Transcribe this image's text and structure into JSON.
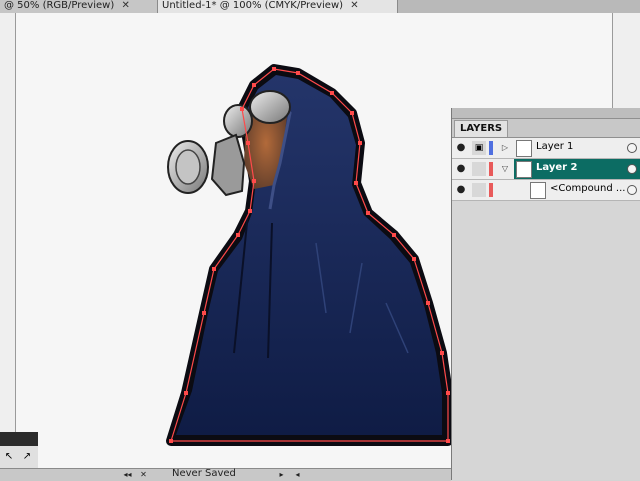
{
  "tabs": [
    {
      "label": "@ 50% (RGB/Preview)",
      "close": "✕"
    },
    {
      "label": "Untitled-1* @ 100% (CMYK/Preview)",
      "close": "✕"
    }
  ],
  "layers_panel": {
    "title": "LAYERS",
    "rows": [
      {
        "name": "Layer 1",
        "color": "#4f6fe0",
        "expand": "▷"
      },
      {
        "name": "Layer 2",
        "color": "#e85a5a",
        "expand": "▽"
      },
      {
        "name": "<Compound ...",
        "color": "#e85a5a",
        "expand": ""
      }
    ]
  },
  "status": {
    "text": "Never Saved",
    "collapse": "◂◂",
    "close": "✕"
  },
  "colors": {
    "hoodie": "#1c2d5b",
    "selection": "#ff4a4a",
    "layer_selected": "#0c6c63"
  },
  "icons": [
    "eye-icon",
    "lock-icon",
    "expand-triangle-icon",
    "target-circle-icon",
    "selection-tool-icon",
    "direct-selection-tool-icon"
  ]
}
